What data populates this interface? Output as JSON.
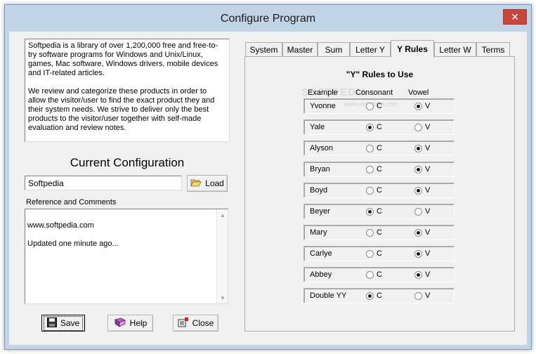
{
  "window": {
    "title": "Configure Program",
    "close_glyph": "✕"
  },
  "description": {
    "paragraphs": [
      "Softpedia is a library of over 1,200,000 free and free-to-try software programs for Windows and Unix/Linux, games, Mac software, Windows drivers, mobile devices and IT-related articles.",
      "We review and categorize these products in order to allow the visitor/user to find the exact product they and their system needs. We strive to deliver only the best products to the visitor/user together with self-made evaluation and review notes."
    ]
  },
  "config": {
    "heading": "Current Configuration",
    "name_value": "Softpedia",
    "load_label": "Load",
    "ref_label": "Reference and Comments",
    "ref_lines": [
      "www.softpedia.com",
      "Updated one minute ago..."
    ]
  },
  "buttons": {
    "save": "Save",
    "help": "Help",
    "close": "Close"
  },
  "tabs": [
    "System",
    "Master",
    "Sum",
    "Letter Y",
    "Y Rules",
    "Letter W",
    "Terms"
  ],
  "active_tab": "Y Rules",
  "rules": {
    "title": "\"Y\" Rules to Use",
    "headers": {
      "example": "Example",
      "consonant": "Consonant",
      "vowel": "Vowel"
    },
    "c_label": "C",
    "v_label": "V",
    "rows": [
      {
        "name": "Yvonne",
        "selected": "V"
      },
      {
        "name": "Yale",
        "selected": "C"
      },
      {
        "name": "Alyson",
        "selected": "V"
      },
      {
        "name": "Bryan",
        "selected": "V"
      },
      {
        "name": "Boyd",
        "selected": "V"
      },
      {
        "name": "Beyer",
        "selected": "C"
      },
      {
        "name": "Mary",
        "selected": "V"
      },
      {
        "name": "Carlye",
        "selected": "V"
      },
      {
        "name": "Abbey",
        "selected": "V"
      },
      {
        "name": "Double YY",
        "selected": "C"
      }
    ]
  },
  "watermark": {
    "main": "SOFTPEDIA",
    "sub": "www.softpedia.com"
  }
}
